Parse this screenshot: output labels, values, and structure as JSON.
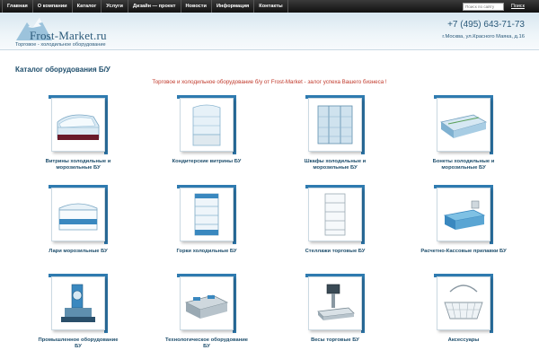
{
  "nav": {
    "items": [
      "Главная",
      "О компании",
      "Каталог",
      "Услуги",
      "Дизайн — проект",
      "Новости",
      "Информация",
      "Контакты"
    ],
    "search_placeholder": "Поиск по сайту",
    "search_label": "Поиск"
  },
  "header": {
    "logo": "Frost-Market.ru",
    "logo_sub": "Торговое - холодильное оборудование",
    "phone": "+7 (495) 643-71-73",
    "address": "г.Москва, ул.Красного Маяка, д.16"
  },
  "main": {
    "title": "Каталог оборудования Б/У",
    "slogan": "Торговое и холодильное оборудование б/у от Frost-Market - залог успеха Вашего бизнеса !",
    "categories": [
      {
        "label": "Витрины холодильные и морозильные БУ",
        "icon": "display-case-icon"
      },
      {
        "label": "Кондитерские витрины БУ",
        "icon": "pastry-display-icon"
      },
      {
        "label": "Шкафы холодильные и морозильные БУ",
        "icon": "fridge-cabinet-icon"
      },
      {
        "label": "Бонеты холодильные и морозильные БУ",
        "icon": "island-freezer-icon"
      },
      {
        "label": "Лари морозильные БУ",
        "icon": "chest-freezer-icon"
      },
      {
        "label": "Горки холодильные БУ",
        "icon": "open-fridge-icon"
      },
      {
        "label": "Стеллажи торговые БУ",
        "icon": "shelving-icon"
      },
      {
        "label": "Расчетно-Кассовые прилавки БУ",
        "icon": "checkout-counter-icon"
      },
      {
        "label": "Промышленное оборудование БУ",
        "icon": "industrial-machine-icon"
      },
      {
        "label": "Технологическое оборудование БУ",
        "icon": "kitchen-equipment-icon"
      },
      {
        "label": "Весы торговые БУ",
        "icon": "scales-icon"
      },
      {
        "label": "Аксессуары",
        "icon": "basket-icon"
      }
    ]
  }
}
